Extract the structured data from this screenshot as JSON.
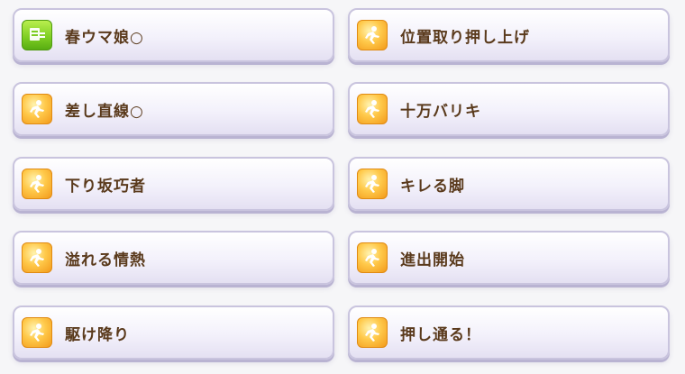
{
  "skills": [
    {
      "name": "春ウマ娘○",
      "icon": "green-card-icon"
    },
    {
      "name": "位置取り押し上げ",
      "icon": "gold-runner-icon"
    },
    {
      "name": "差し直線○",
      "icon": "gold-runner-icon"
    },
    {
      "name": "十万バリキ",
      "icon": "gold-runner-icon"
    },
    {
      "name": "下り坂巧者",
      "icon": "gold-runner-icon"
    },
    {
      "name": "キレる脚",
      "icon": "gold-runner-icon"
    },
    {
      "name": "溢れる情熱",
      "icon": "gold-runner-icon"
    },
    {
      "name": "進出開始",
      "icon": "gold-runner-icon"
    },
    {
      "name": "駆け降り",
      "icon": "gold-runner-icon"
    },
    {
      "name": "押し通る！",
      "icon": "gold-runner-icon"
    }
  ],
  "colors": {
    "card_border": "#c9c4de",
    "label_text": "#5a3a1c",
    "gold_icon": "#f29a1a",
    "green_icon": "#7ccc22"
  }
}
